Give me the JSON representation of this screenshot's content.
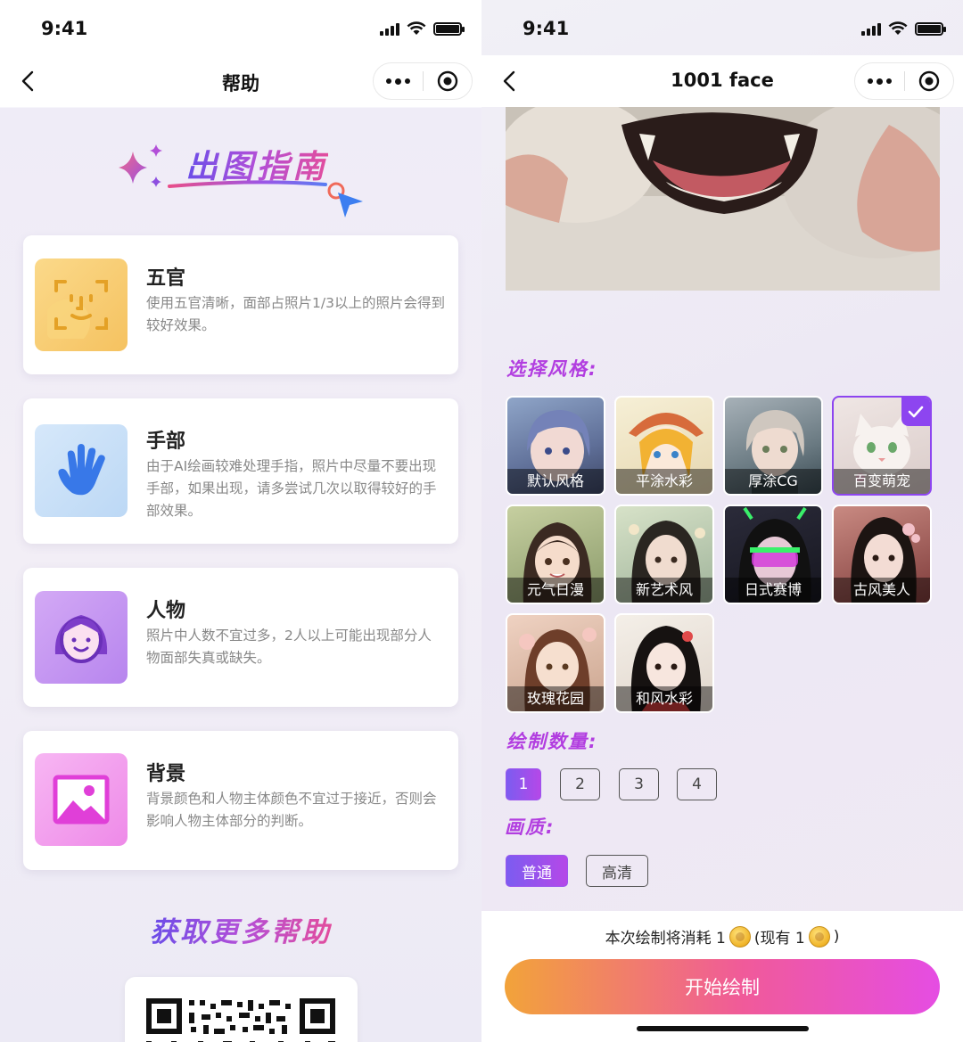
{
  "status": {
    "time": "9:41"
  },
  "help_page": {
    "nav_title": "帮助",
    "guide_title": "出图指南",
    "cards": [
      {
        "title": "五官",
        "desc": "使用五官清晰，面部占照片1/3以上的照片会得到较好效果。",
        "icon": "face-scan-icon",
        "color": "#f7cc72"
      },
      {
        "title": "手部",
        "desc": "由于AI绘画较难处理手指，照片中尽量不要出现手部，如果出现，请多尝试几次以取得较好的手部效果。",
        "icon": "hand-icon",
        "color": "#c9e0f7"
      },
      {
        "title": "人物",
        "desc": "照片中人数不宜过多，2人以上可能出现部分人物面部失真或缺失。",
        "icon": "person-icon",
        "color": "#c08df0"
      },
      {
        "title": "背景",
        "desc": "背景颜色和人物主体颜色不宜过于接近，否则会影响人物主体部分的判断。",
        "icon": "image-icon",
        "color": "#f09af0"
      }
    ],
    "more_help": "获取更多帮助"
  },
  "face_page": {
    "nav_title": "1001 face",
    "style_label": "选择风格:",
    "styles": [
      {
        "label": "默认风格",
        "selected": false
      },
      {
        "label": "平涂水彩",
        "selected": false
      },
      {
        "label": "厚涂CG",
        "selected": false
      },
      {
        "label": "百变萌宠",
        "selected": true
      },
      {
        "label": "元气日漫",
        "selected": false
      },
      {
        "label": "新艺术风",
        "selected": false
      },
      {
        "label": "日式赛博",
        "selected": false
      },
      {
        "label": "古风美人",
        "selected": false
      },
      {
        "label": "玫瑰花园",
        "selected": false
      },
      {
        "label": "和风水彩",
        "selected": false
      }
    ],
    "count_label": "绘制数量:",
    "counts": [
      "1",
      "2",
      "3",
      "4"
    ],
    "count_selected": "1",
    "quality_label": "画质:",
    "qualities": [
      "普通",
      "高清"
    ],
    "quality_selected": "普通",
    "cost_prefix": "本次绘制将消耗 1",
    "cost_have": "(现有 1",
    "cost_suffix": ")",
    "start_button": "开始绘制"
  },
  "colors": {
    "accent": "#8d45f0",
    "label_purple": "#b23ee0",
    "button_start": "#f2a33a",
    "button_end": "#e54de3"
  }
}
